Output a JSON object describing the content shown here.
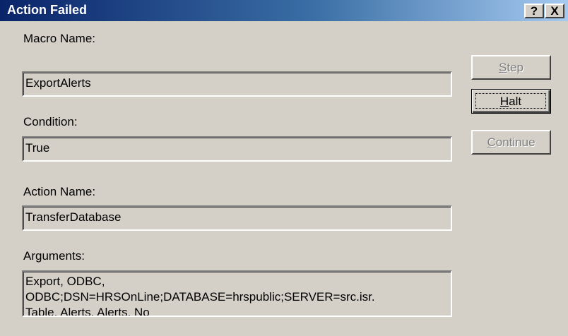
{
  "window": {
    "title": "Action Failed",
    "help_glyph": "?",
    "close_glyph": "X"
  },
  "fields": {
    "macro_name": {
      "label": "Macro Name:",
      "value": "ExportAlerts"
    },
    "condition": {
      "label": "Condition:",
      "value": "True"
    },
    "action_name": {
      "label": "Action Name:",
      "value": "TransferDatabase"
    },
    "arguments": {
      "label": "Arguments:",
      "value": "Export, ODBC,\nODBC;DSN=HRSOnLine;DATABASE=hrspublic;SERVER=src.isr.\nTable, Alerts, Alerts, No"
    }
  },
  "buttons": {
    "step": {
      "access_key": "S",
      "rest": "tep",
      "state": "disabled"
    },
    "halt": {
      "access_key": "H",
      "rest": "alt",
      "state": "default"
    },
    "continue": {
      "access_key": "C",
      "rest": "ontinue",
      "state": "disabled"
    }
  }
}
